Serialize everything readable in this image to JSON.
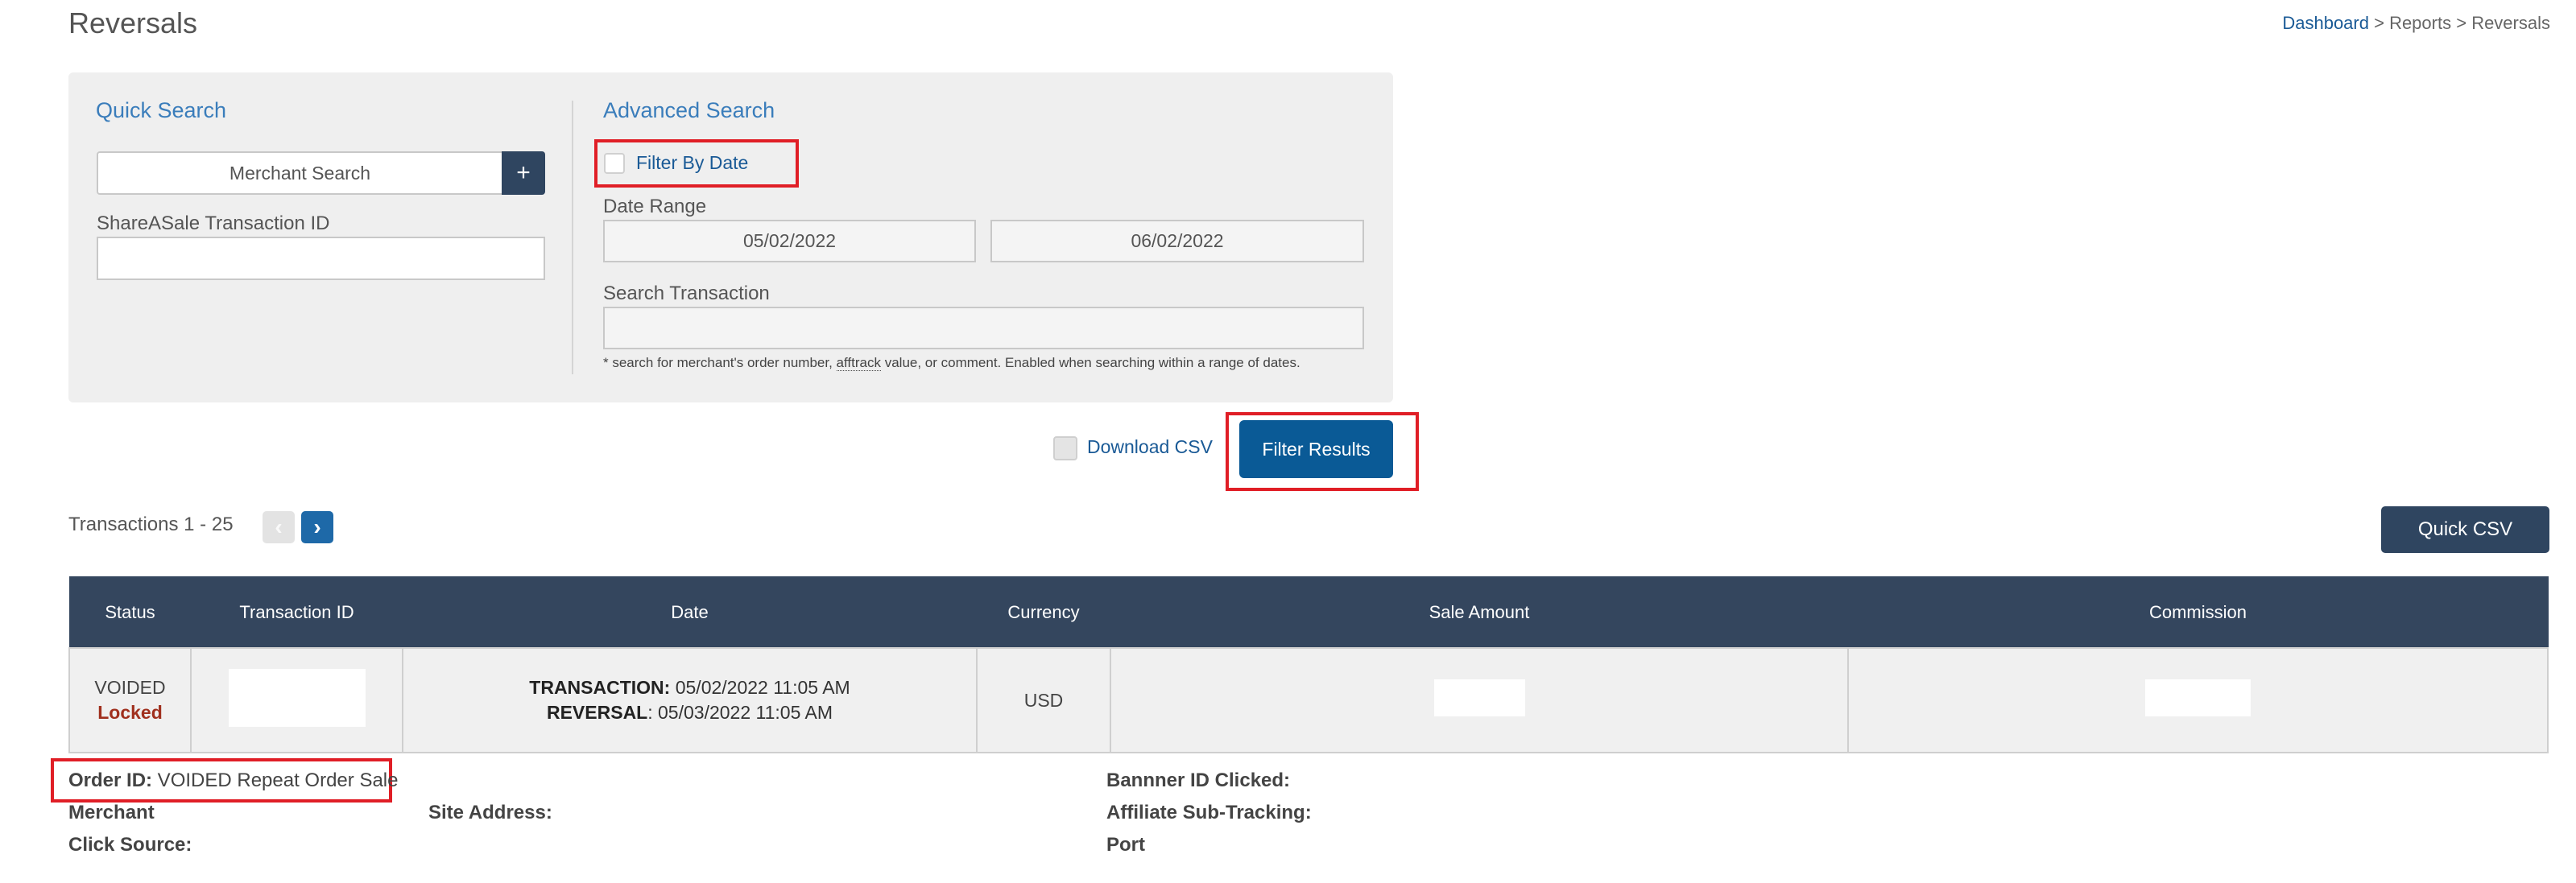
{
  "page": {
    "title": "Reversals"
  },
  "breadcrumb": {
    "home": "Dashboard",
    "sep1": " > ",
    "section": "Reports",
    "sep2": " > ",
    "current": "Reversals"
  },
  "quick_search": {
    "title": "Quick Search",
    "merchant_placeholder": "Merchant Search",
    "merchant_value": "Merchant Search",
    "add_icon": "plus-icon",
    "transaction_id_label": "ShareASale Transaction ID",
    "transaction_id_value": ""
  },
  "advanced_search": {
    "title": "Advanced Search",
    "filter_by_date_label": "Filter By Date",
    "filter_by_date_checked": false,
    "date_range_label": "Date Range",
    "date_start": "05/02/2022",
    "date_end": "06/02/2022",
    "search_transaction_label": "Search Transaction",
    "search_transaction_value": "",
    "hint_before": "* search for merchant's order number, ",
    "hint_term": "afftrack",
    "hint_after": " value, or comment. Enabled when searching within a range of dates."
  },
  "actions": {
    "download_csv_label": "Download CSV",
    "download_csv_checked": false,
    "filter_results_label": "Filter Results",
    "quick_csv_label": "Quick CSV"
  },
  "pagination": {
    "summary": "Transactions 1 - 25",
    "prev_icon": "chevron-left-icon",
    "next_icon": "chevron-right-icon"
  },
  "table": {
    "columns": [
      "Status",
      "Transaction ID",
      "Date",
      "Currency",
      "Sale Amount",
      "Commission"
    ],
    "rows": [
      {
        "status": "VOIDED",
        "lock_status": "Locked",
        "transaction_id": "",
        "transaction_label": "TRANSACTION:",
        "transaction_date": " 05/02/2022 11:05 AM",
        "reversal_label": "REVERSAL",
        "reversal_date": ": 05/03/2022 11:05 AM",
        "currency": "USD",
        "sale_amount": "",
        "commission": ""
      }
    ]
  },
  "details": {
    "order_id_label": "Order ID:",
    "order_id_value": " VOIDED Repeat Order Sale",
    "merchant_label": "Merchant",
    "site_address_label": "Site Address:",
    "click_source_label": "Click Source:",
    "banner_id_label": "Bannner ID Clicked:",
    "affiliate_subtracking_label": "Affiliate Sub-Tracking:",
    "port_label": "Port"
  },
  "colors": {
    "header_bg": "#34465e",
    "accent_blue": "#0a5a96",
    "link_blue": "#1a5a96",
    "highlight_red": "#e01e26",
    "locked_red": "#a0301e"
  }
}
